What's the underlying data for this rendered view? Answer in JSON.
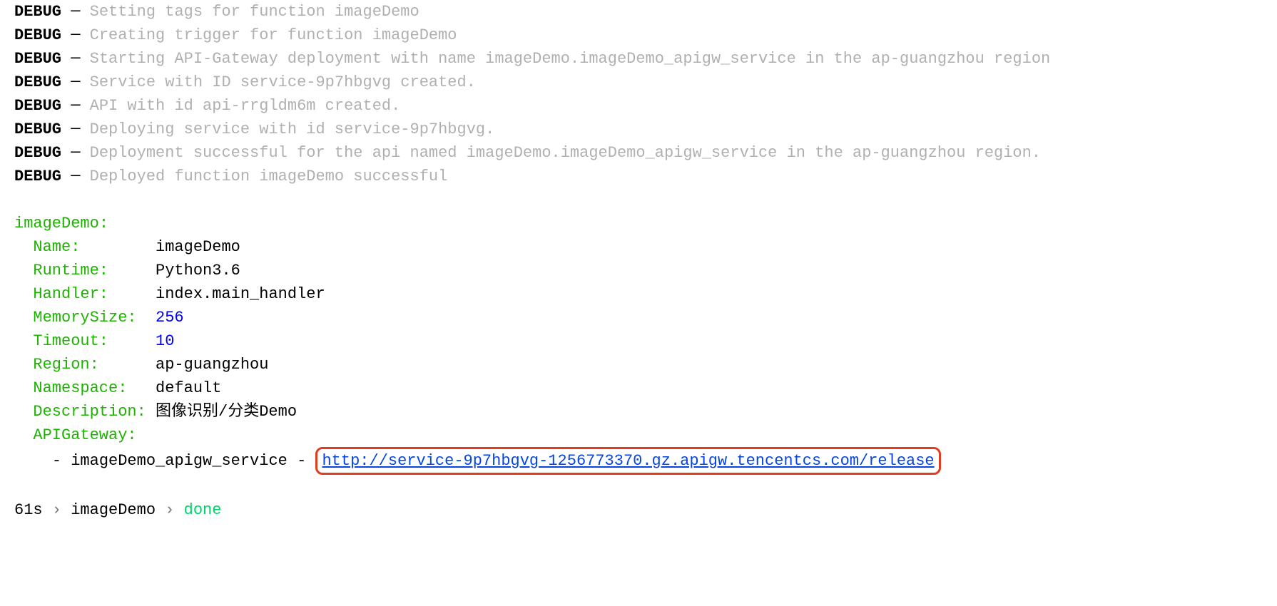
{
  "debug_lines": [
    {
      "label": "DEBUG",
      "dash": "─",
      "msg": "Setting tags for function imageDemo"
    },
    {
      "label": "DEBUG",
      "dash": "─",
      "msg": "Creating trigger for function imageDemo"
    },
    {
      "label": "DEBUG",
      "dash": "─",
      "msg": "Starting API-Gateway deployment with name imageDemo.imageDemo_apigw_service in the ap-guangzhou region"
    },
    {
      "label": "DEBUG",
      "dash": "─",
      "msg": "Service with ID service-9p7hbgvg created."
    },
    {
      "label": "DEBUG",
      "dash": "─",
      "msg": "API with id api-rrgldm6m created."
    },
    {
      "label": "DEBUG",
      "dash": "─",
      "msg": "Deploying service with id service-9p7hbgvg."
    },
    {
      "label": "DEBUG",
      "dash": "─",
      "msg": "Deployment successful for the api named imageDemo.imageDemo_apigw_service in the ap-guangzhou region."
    },
    {
      "label": "DEBUG",
      "dash": "─",
      "msg": "Deployed function imageDemo successful"
    }
  ],
  "section": {
    "header": "imageDemo:",
    "rows": [
      {
        "key": "Name:       ",
        "val": "imageDemo",
        "type": "text"
      },
      {
        "key": "Runtime:    ",
        "val": "Python3.6",
        "type": "text"
      },
      {
        "key": "Handler:    ",
        "val": "index.main_handler",
        "type": "text"
      },
      {
        "key": "MemorySize: ",
        "val": "256",
        "type": "num"
      },
      {
        "key": "Timeout:    ",
        "val": "10",
        "type": "num"
      },
      {
        "key": "Region:     ",
        "val": "ap-guangzhou",
        "type": "text"
      },
      {
        "key": "Namespace:  ",
        "val": "default",
        "type": "text"
      },
      {
        "key": "Description:",
        "val": "图像识别/分类Demo",
        "type": "text"
      }
    ],
    "apigw_label": "APIGateway:",
    "apigw_item": {
      "dash": "-",
      "name": "imageDemo_apigw_service",
      "sep": "-",
      "url": "http://service-9p7hbgvg-1256773370.gz.apigw.tencentcs.com/release"
    }
  },
  "status": {
    "time": "61s",
    "sep": "›",
    "name": "imageDemo",
    "state": "done"
  }
}
